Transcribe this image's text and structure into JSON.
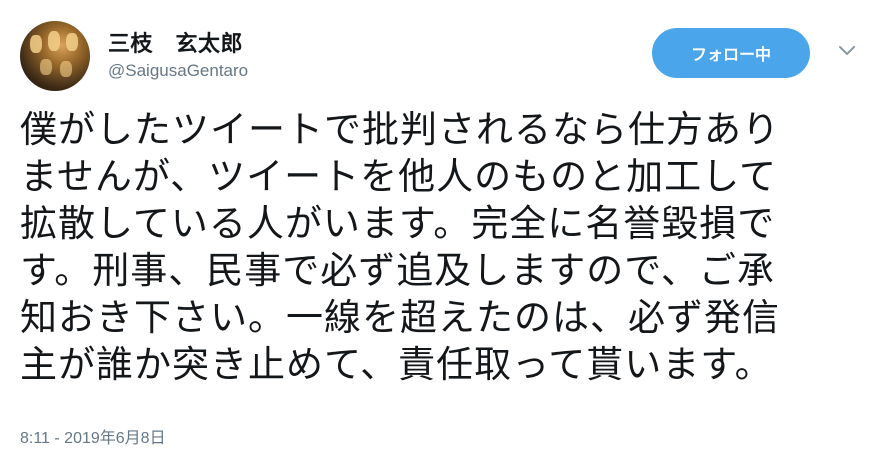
{
  "tweet": {
    "author": {
      "name": "三枝　玄太郎",
      "handle": "@SaigusaGentaro"
    },
    "follow_button_label": "フォロー中",
    "text_lines": [
      "僕がしたツイートで批判されるなら仕方あり",
      "ませんが、ツイートを他人のものと加工して",
      "拡散している人がいます。完全に名誉毀損で",
      "す。刑事、民事で必ず追及しますので、ご承",
      "知おき下さい。一線を超えたのは、必ず発信",
      "主が誰か突き止めて、責任取って貰います。"
    ],
    "timestamp": "8:11 - 2019年6月8日"
  },
  "colors": {
    "accent": "#4aa5ea",
    "secondary_text": "#657786",
    "primary_text": "#14171a"
  },
  "icons": {
    "caret": "chevron-down-icon"
  }
}
